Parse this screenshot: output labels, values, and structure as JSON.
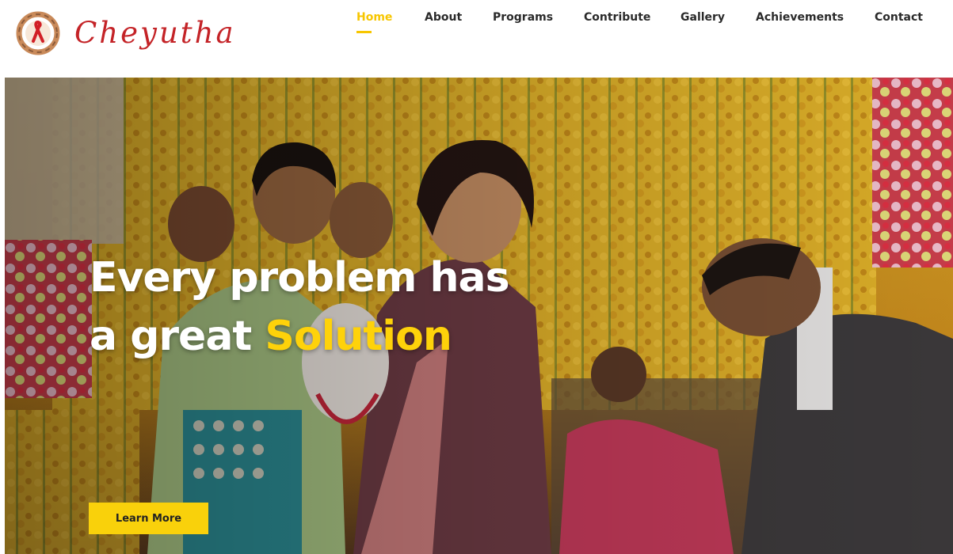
{
  "brand": {
    "name": "Cheyutha",
    "emblem": "red-ribbon-hands-logo",
    "color": "#c42327"
  },
  "nav": {
    "active_color": "#f7c600",
    "items": [
      {
        "label": "Home",
        "active": true
      },
      {
        "label": "About",
        "active": false
      },
      {
        "label": "Programs",
        "active": false
      },
      {
        "label": "Contribute",
        "active": false
      },
      {
        "label": "Gallery",
        "active": false
      },
      {
        "label": "Achievements",
        "active": false
      },
      {
        "label": "Contact",
        "active": false
      }
    ]
  },
  "hero": {
    "headline_line1": "Every problem has",
    "headline_line2_prefix": "a great ",
    "headline_highlight": "Solution",
    "highlight_color": "#fed20a",
    "cta_label": "Learn More",
    "cta_color": "#f9d10b"
  }
}
